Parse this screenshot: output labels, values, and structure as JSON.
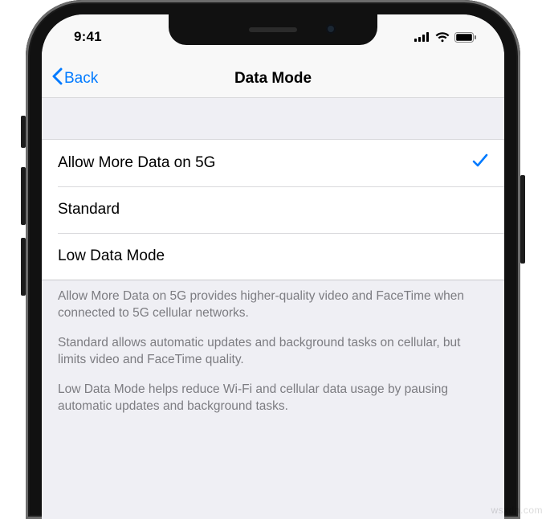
{
  "status": {
    "time": "9:41"
  },
  "nav": {
    "back_label": "Back",
    "title": "Data Mode"
  },
  "options": [
    {
      "label": "Allow More Data on 5G",
      "selected": true
    },
    {
      "label": "Standard",
      "selected": false
    },
    {
      "label": "Low Data Mode",
      "selected": false
    }
  ],
  "footer": {
    "p1": "Allow More Data on 5G provides higher-quality video and FaceTime when connected to 5G cellular networks.",
    "p2": "Standard allows automatic updates and background tasks on cellular, but limits video and FaceTime quality.",
    "p3": "Low Data Mode helps reduce Wi-Fi and cellular data usage by pausing automatic updates and background tasks."
  },
  "watermark": "wsxdn.com"
}
